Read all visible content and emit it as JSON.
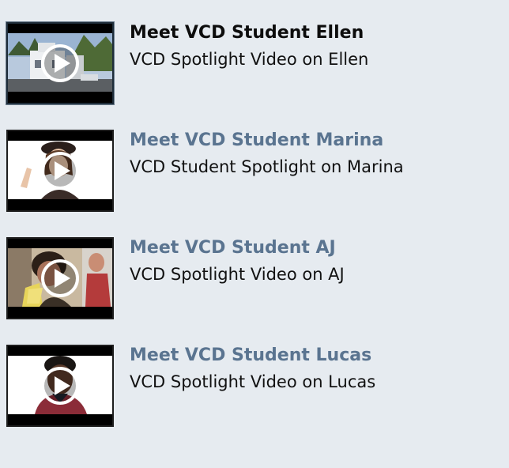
{
  "videos": [
    {
      "title": "Meet VCD Student Ellen",
      "subtitle": "VCD Spotlight Video on Ellen",
      "thumbnail_icon": "play-icon",
      "current": true
    },
    {
      "title": "Meet VCD Student Marina",
      "subtitle": "VCD Student Spotlight on Marina",
      "thumbnail_icon": "play-icon",
      "current": false
    },
    {
      "title": "Meet VCD Student AJ",
      "subtitle": "VCD Spotlight Video on AJ",
      "thumbnail_icon": "play-icon",
      "current": false
    },
    {
      "title": "Meet VCD Student Lucas",
      "subtitle": "VCD Spotlight Video on Lucas",
      "thumbnail_icon": "play-icon",
      "current": false
    }
  ],
  "colors": {
    "background": "#e6ebf0",
    "link": "#5a7490",
    "current_title": "#0d0d0d",
    "thumbnail_border": "#1d1d1d"
  }
}
